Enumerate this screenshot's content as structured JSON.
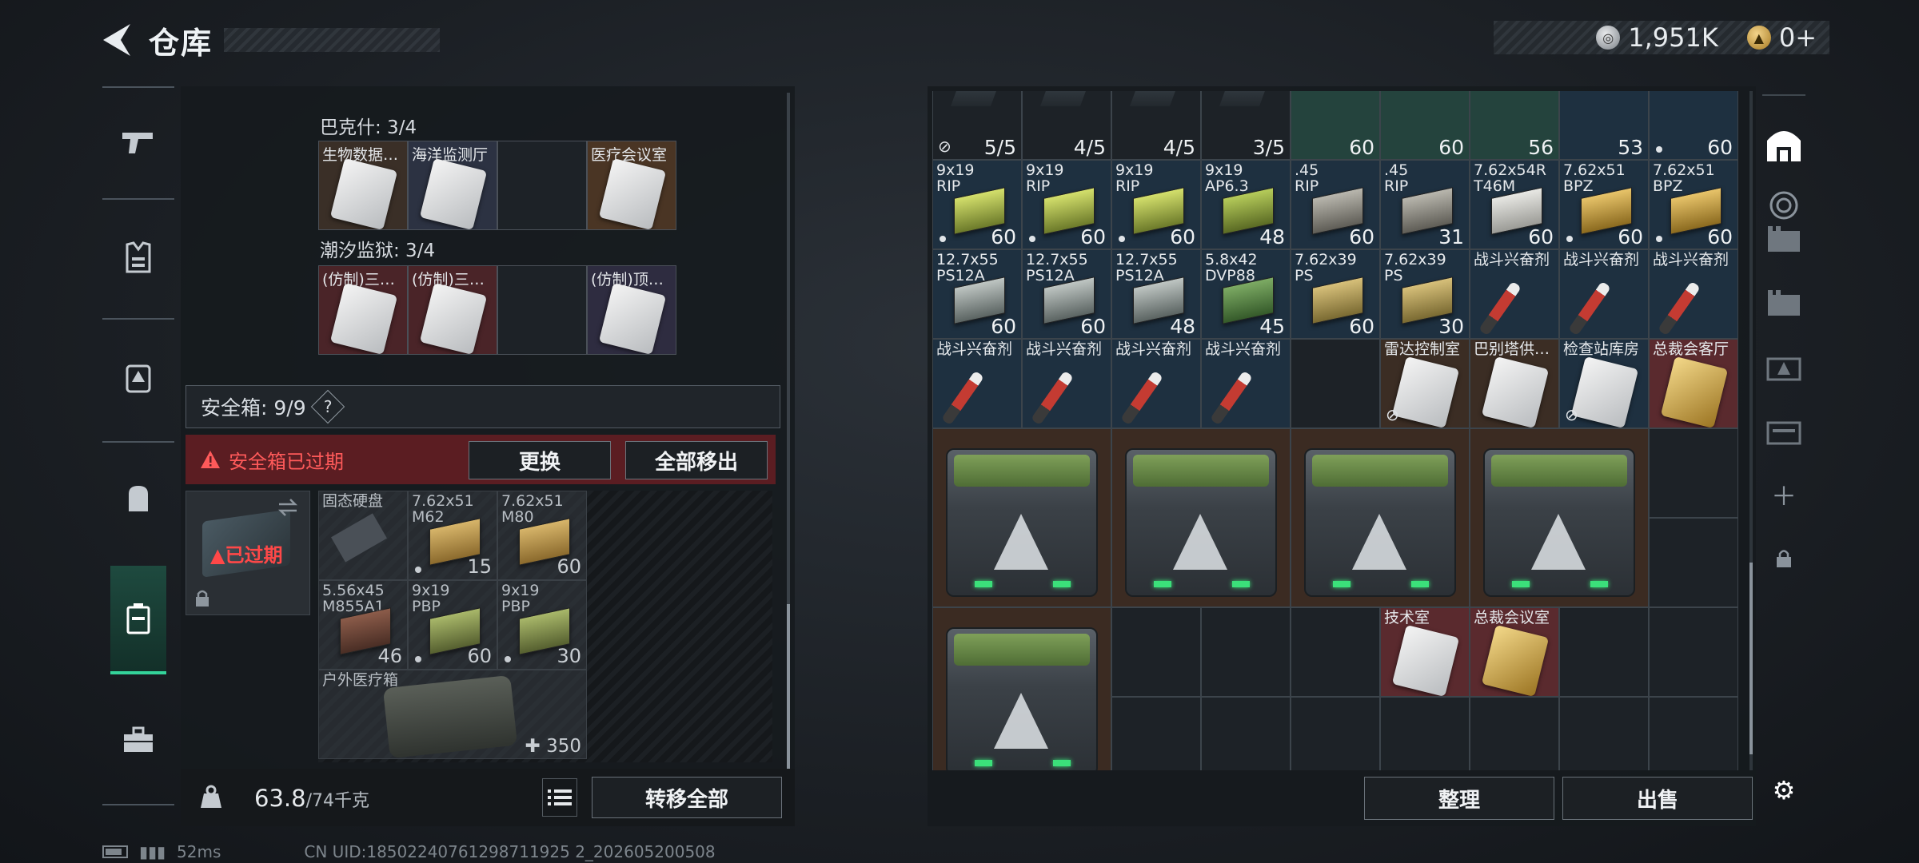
{
  "header": {
    "title": "仓库",
    "silver_amount": "1,951K",
    "gold_amount": "0+"
  },
  "left": {
    "groups": [
      {
        "title": "巴克什: 3/4",
        "slots": [
          "生物数据…",
          "海洋监测厅",
          "",
          "医疗会议室"
        ]
      },
      {
        "title": "潮汐监狱: 3/4",
        "slots": [
          "(仿制)三…",
          "(仿制)三…",
          "",
          "(仿制)顶…"
        ]
      }
    ],
    "safe_label": "安全箱: 9/9",
    "help": "?",
    "expired_warning": "安全箱已过期",
    "replace_button": "更换",
    "move_all_out_button": "全部移出",
    "safe_expired_tag": "已过期",
    "safe_items": [
      {
        "label": "固态硬盘",
        "qty": ""
      },
      {
        "label": "7.62x51\nM62",
        "qty": "15"
      },
      {
        "label": "7.62x51\nM80",
        "qty": "60"
      },
      {
        "label": "5.56x45\nM855A1",
        "qty": "46"
      },
      {
        "label": "9x19\nPBP",
        "qty": "60"
      },
      {
        "label": "9x19\nPBP",
        "qty": "30"
      },
      {
        "label": "户外医疗箱",
        "qty": "350"
      }
    ],
    "weight_current": "63.8",
    "weight_max": "/74千克",
    "transfer_all_button": "转移全部"
  },
  "right": {
    "row1": [
      {
        "label": "",
        "qty": "5/5"
      },
      {
        "label": "",
        "qty": "4/5"
      },
      {
        "label": "",
        "qty": "4/5"
      },
      {
        "label": "",
        "qty": "3/5"
      },
      {
        "label": "",
        "qty": "60"
      },
      {
        "label": "",
        "qty": "60"
      },
      {
        "label": "",
        "qty": "56"
      },
      {
        "label": "",
        "qty": "53"
      },
      {
        "label": "",
        "qty": "60"
      }
    ],
    "row2": [
      {
        "label": "9x19\nRIP",
        "qty": "60"
      },
      {
        "label": "9x19\nRIP",
        "qty": "60"
      },
      {
        "label": "9x19\nRIP",
        "qty": "60"
      },
      {
        "label": "9x19\nAP6.3",
        "qty": "48"
      },
      {
        "label": ".45\nRIP",
        "qty": "60"
      },
      {
        "label": ".45\nRIP",
        "qty": "31"
      },
      {
        "label": "7.62x54R\nT46M",
        "qty": "60"
      },
      {
        "label": "7.62x51\nBPZ",
        "qty": "60"
      },
      {
        "label": "7.62x51\nBPZ",
        "qty": "60"
      }
    ],
    "row3": [
      {
        "label": "12.7x55\nPS12A",
        "qty": "60"
      },
      {
        "label": "12.7x55\nPS12A",
        "qty": "60"
      },
      {
        "label": "12.7x55\nPS12A",
        "qty": "48"
      },
      {
        "label": "5.8x42\nDVP88",
        "qty": "45"
      },
      {
        "label": "7.62x39\nPS",
        "qty": "60"
      },
      {
        "label": "7.62x39\nPS",
        "qty": "30"
      },
      {
        "label": "战斗兴奋剂",
        "qty": ""
      },
      {
        "label": "战斗兴奋剂",
        "qty": ""
      },
      {
        "label": "战斗兴奋剂",
        "qty": ""
      }
    ],
    "row4": [
      {
        "label": "战斗兴奋剂"
      },
      {
        "label": "战斗兴奋剂"
      },
      {
        "label": "战斗兴奋剂"
      },
      {
        "label": "战斗兴奋剂"
      },
      {
        "label": ""
      },
      {
        "label": "雷达控制室"
      },
      {
        "label": "巴别塔供…"
      },
      {
        "label": "检查站库房"
      },
      {
        "label": "总裁会客厅"
      }
    ],
    "keys_row6": [
      "技术室",
      "总裁会议室"
    ],
    "sort_button": "整理",
    "sell_button": "出售"
  },
  "status": {
    "ping": "52ms",
    "uid": "CN UID:18502240761298711925 2_202605200508"
  },
  "colors": {
    "accent_green": "#34d39a",
    "warning_red": "#ff5a5a"
  }
}
